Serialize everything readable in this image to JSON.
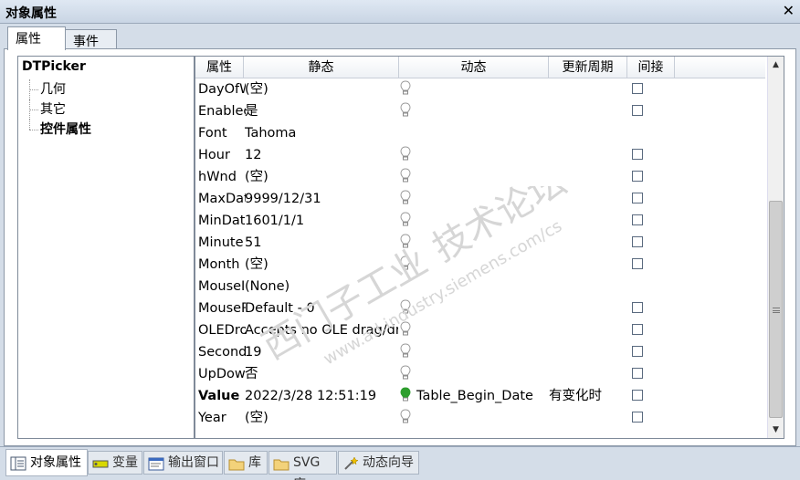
{
  "window": {
    "title": "对象属性",
    "close_label": "✕"
  },
  "top_tabs": [
    {
      "label": "属性"
    },
    {
      "label": "事件"
    }
  ],
  "tree": {
    "root": "DTPicker",
    "children": [
      {
        "label": "几何"
      },
      {
        "label": "其它"
      },
      {
        "label": "控件属性"
      }
    ]
  },
  "grid": {
    "headers": {
      "prop": "属性",
      "static": "静态",
      "dynamic": "动态",
      "period": "更新周期",
      "indirect": "间接"
    },
    "rows": [
      {
        "prop": "DayOfWeek",
        "static": "(空)",
        "dynamic": "",
        "period": ""
      },
      {
        "prop": "Enabled",
        "static": "是",
        "dynamic": "",
        "period": ""
      },
      {
        "prop": "Font",
        "static": "Tahoma",
        "dynamic": "",
        "period": ""
      },
      {
        "prop": "Hour",
        "static": "12",
        "dynamic": "",
        "period": ""
      },
      {
        "prop": "hWnd",
        "static": "(空)",
        "dynamic": "",
        "period": ""
      },
      {
        "prop": "MaxDate",
        "static": "9999/12/31",
        "dynamic": "",
        "period": ""
      },
      {
        "prop": "MinDate",
        "static": "1601/1/1",
        "dynamic": "",
        "period": ""
      },
      {
        "prop": "Minute",
        "static": "51",
        "dynamic": "",
        "period": ""
      },
      {
        "prop": "Month",
        "static": "(空)",
        "dynamic": "",
        "period": ""
      },
      {
        "prop": "MouseIcon",
        "static": "(None)",
        "dynamic": "",
        "period": ""
      },
      {
        "prop": "MousePointer",
        "static": "Default - 0",
        "dynamic": "",
        "period": ""
      },
      {
        "prop": "OLEDropMode",
        "static": "Accepts no OLE drag/drop",
        "dynamic": "",
        "period": ""
      },
      {
        "prop": "Second",
        "static": "19",
        "dynamic": "",
        "period": ""
      },
      {
        "prop": "UpDown",
        "static": "否",
        "dynamic": "",
        "period": ""
      },
      {
        "prop": "Value",
        "static": "2022/3/28 12:51:19",
        "dynamic": "Table_Begin_Date",
        "period": "有变化时"
      },
      {
        "prop": "Year",
        "static": "(空)",
        "dynamic": "",
        "period": ""
      }
    ]
  },
  "watermark": {
    "line1": "西门子工业",
    "line2": "技术论坛",
    "url": "www.ad.industry.siemens.com/cs"
  },
  "bottom_tabs": [
    {
      "label": "对象属性"
    },
    {
      "label": "变量"
    },
    {
      "label": "输出窗口"
    },
    {
      "label": "库"
    },
    {
      "label": "SVG 库"
    },
    {
      "label": "动态向导"
    }
  ],
  "colors": {
    "bulb_active": "#2e9e2e",
    "bulb_inactive": "#9a9a9a",
    "accent": "#d4dde8"
  }
}
